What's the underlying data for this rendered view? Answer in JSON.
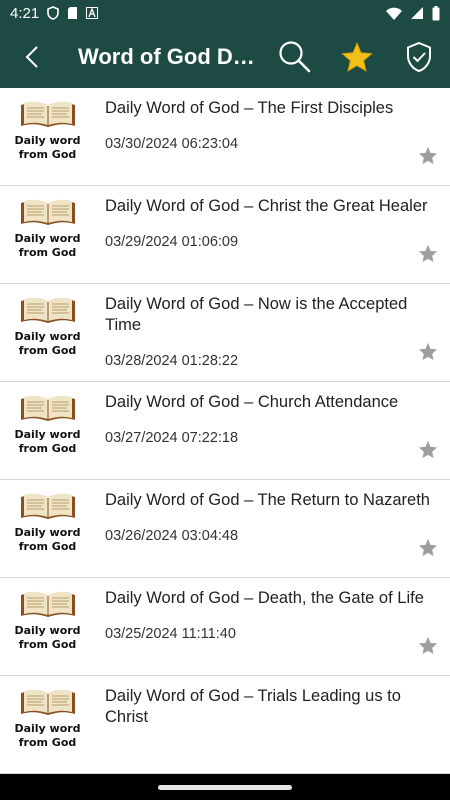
{
  "status_bar": {
    "time": "4:21",
    "icons": [
      "shield-icon",
      "sd-card-icon",
      "font-a-icon",
      "wifi-icon",
      "signal-icon",
      "battery-icon"
    ]
  },
  "app_bar": {
    "title": "Word of God De...",
    "background_color": "#1d4a43",
    "actions": [
      "search-icon",
      "star-icon",
      "shield-check-icon"
    ],
    "star_color": "#f2c01a"
  },
  "thumbnail": {
    "caption_line1": "Daily word",
    "caption_line2": "from God"
  },
  "items": [
    {
      "title": "Daily Word of God – The First Disciples",
      "date": "03/30/2024 06:23:04"
    },
    {
      "title": "Daily Word of God – Christ the Great Healer",
      "date": "03/29/2024 01:06:09"
    },
    {
      "title": "Daily Word of God – Now is the Accepted Time",
      "date": "03/28/2024 01:28:22"
    },
    {
      "title": "Daily Word of God – Church Attendance",
      "date": "03/27/2024 07:22:18"
    },
    {
      "title": "Daily Word of God – The Return to Nazareth",
      "date": "03/26/2024 03:04:48"
    },
    {
      "title": "Daily Word of God – Death, the Gate of Life",
      "date": "03/25/2024 11:11:40"
    },
    {
      "title": "Daily Word of God – Trials Leading us to Christ",
      "date": ""
    }
  ]
}
